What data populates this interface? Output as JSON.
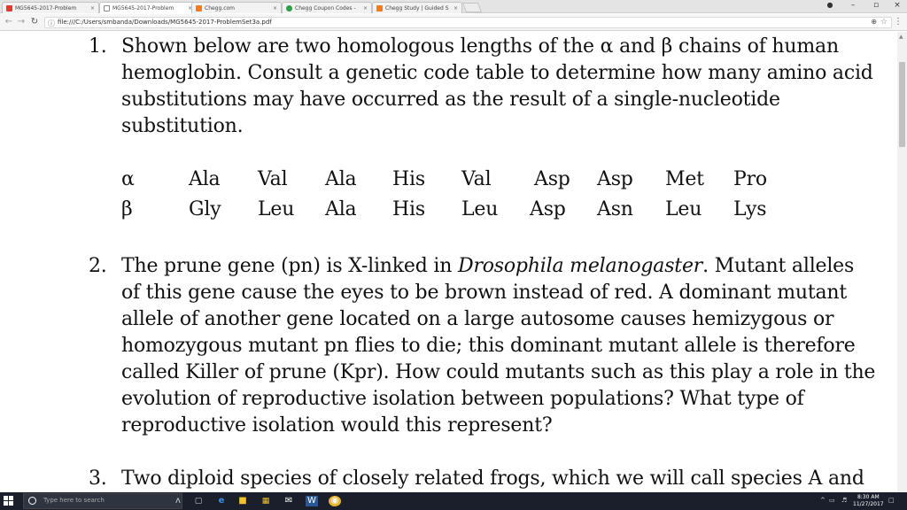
{
  "browser": {
    "tabs": [
      {
        "title": "MG5645-2017-Problem",
        "favicon_color": "#e53935",
        "active": false
      },
      {
        "title": "MG5645-2017-Problem",
        "favicon_color": "#ffffff",
        "active": true
      },
      {
        "title": "Chegg.com",
        "favicon_color": "#f47b20",
        "active": false
      },
      {
        "title": "Chegg Coupon Codes -",
        "favicon_color": "#2e9d48",
        "active": false
      },
      {
        "title": "Chegg Study | Guided S",
        "favicon_color": "#f47b20",
        "active": false
      }
    ],
    "tab_close": "×",
    "url": "file:///C:/Users/smbanda/Downloads/MG5645-2017-ProblemSet3a.pdf",
    "window_controls": {
      "minimize": "–",
      "maximize": "▫",
      "close": "×"
    },
    "profile_icon": "user-icon"
  },
  "document": {
    "q1": {
      "number": "1.",
      "lines": [
        "Shown below are two homologous lengths of the α and β chains of human",
        "hemoglobin.  Consult a genetic code table to determine how many amino acid",
        "substitutions may have occurred as the result of a single-nucleotide",
        "substitution."
      ]
    },
    "sequences": {
      "alpha": {
        "label": "α",
        "residues": [
          "Ala",
          "Val",
          "Ala",
          "His",
          "Val",
          "Asp",
          "Asp",
          "Met",
          "Pro"
        ]
      },
      "beta": {
        "label": "β",
        "residues": [
          "Gly",
          "Leu",
          "Ala",
          "His",
          "Leu",
          "Asp",
          "Asn",
          "Leu",
          "Lys"
        ]
      }
    },
    "q2": {
      "number": "2.",
      "line1_pre": "The prune gene (pn) is X-linked in ",
      "line1_italic": "Drosophila melanogaster",
      "line1_post": ".  Mutant alleles",
      "lines": [
        "of this gene cause the eyes to be brown instead of red.  A dominant mutant",
        "allele of another gene located on a large autosome causes hemizygous or",
        "homozygous mutant pn flies to die; this dominant mutant allele is therefore",
        "called Killer of prune (Kpr).  How could mutants such as this play a role in the",
        "evolution of reproductive isolation between populations?  What type of",
        "reproductive isolation would this represent?"
      ]
    },
    "q3": {
      "number": "3.",
      "line": "Two diploid species of closely related frogs, which we will call species A and"
    }
  },
  "taskbar": {
    "search_placeholder": "Type here to search",
    "time": "8:30 AM",
    "date": "11/27/2017"
  }
}
